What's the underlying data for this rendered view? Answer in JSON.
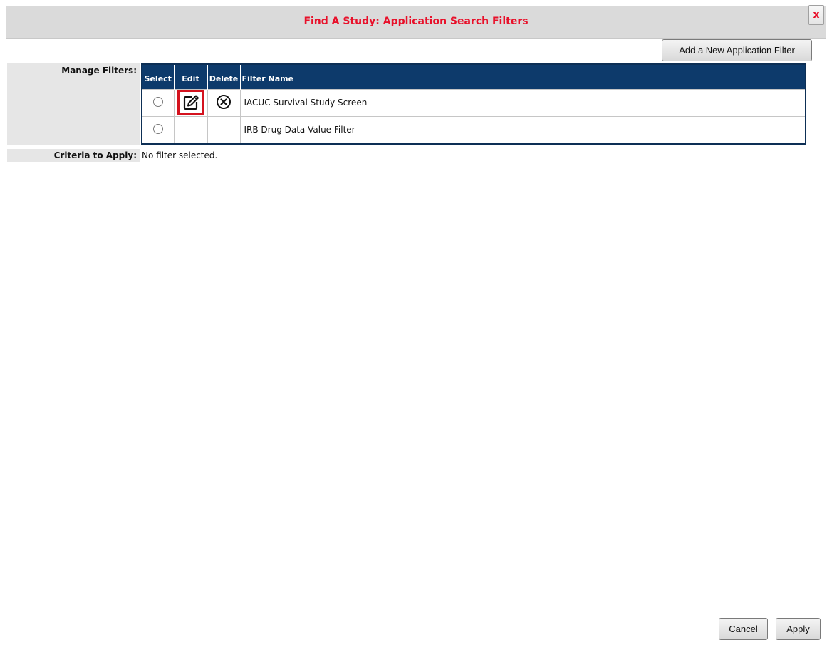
{
  "dialog": {
    "title": "Find A Study: Application Search Filters",
    "close_label": "x"
  },
  "toolbar": {
    "add_filter_label": "Add a New Application Filter"
  },
  "manage": {
    "label": "Manage Filters:",
    "columns": [
      "Select",
      "Edit",
      "Delete",
      "Filter Name"
    ],
    "rows": [
      {
        "name": "IACUC Survival Study Screen",
        "has_edit": true,
        "has_delete": true
      },
      {
        "name": "IRB Drug Data Value Filter",
        "has_edit": false,
        "has_delete": false
      }
    ]
  },
  "criteria": {
    "label": "Criteria to Apply:",
    "value": "No filter selected."
  },
  "footer": {
    "cancel_label": "Cancel",
    "apply_label": "Apply"
  },
  "icons": {
    "edit": "edit-icon",
    "delete": "delete-circle-x-icon"
  },
  "colors": {
    "title": "#e8102a",
    "table_header": "#0d3a6b",
    "highlight": "#d4121e"
  }
}
